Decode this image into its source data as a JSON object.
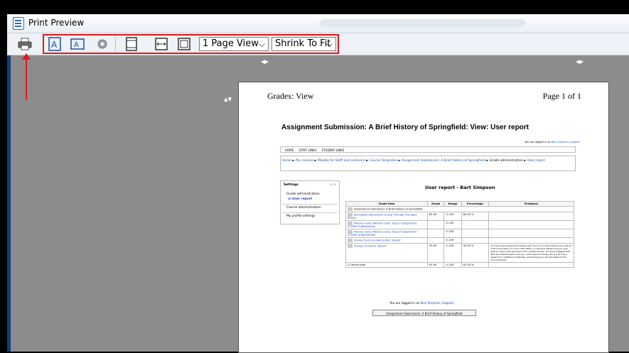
{
  "window": {
    "title": "Print Preview"
  },
  "toolbar": {
    "print_icon": "printer-icon",
    "portrait_icon": "portrait-icon",
    "landscape_icon": "landscape-icon",
    "page_setup_icon": "gear-icon",
    "header_footer_icon": "header-footer-icon",
    "full_width_icon": "full-width-icon",
    "full_page_icon": "full-page-icon",
    "view_select": "1 Page View",
    "scale_select": "Shrink To Fit",
    "highlight_color": "#e01818"
  },
  "page": {
    "header_left": "Grades: View",
    "header_right": "Page 1 of 1",
    "report_title": "Assignment Submission: A Brief History of Springfield: View: User report",
    "logged_text": "You are logged in as",
    "logged_user": "Bart Simpson",
    "logout": "(Logout)",
    "nav": [
      "HOME",
      "STAFF LINKS",
      "STUDENT LINKS"
    ],
    "breadcrumb": [
      "Home",
      "My courses",
      "Moodle for Staff and Lecturers",
      "Course Templates",
      "Assignment Submission: A Brief History of Springfield",
      "Grade administration",
      "User report"
    ],
    "breadcrumb_sep": "►",
    "settings": {
      "title": "Settings",
      "items": [
        "Grade administration",
        "User report",
        "Course administration",
        "My profile settings"
      ]
    },
    "user_report_title": "User report - Bart Simpson",
    "grades_table": {
      "headers": [
        "Grade item",
        "Grade",
        "Range",
        "Percentage",
        "Feedback"
      ],
      "category": "Assignment Submission: A Brief History of Springfield",
      "rows": [
        {
          "item": "Springfield Elementary School Through The Ages: Report",
          "grade": "84.00",
          "range": "0–100",
          "pct": "84.00 %",
          "feedback": ""
        },
        {
          "item": "Module name (Module code): Type of assignment (OTHER SUBMISSION)",
          "grade": "-",
          "range": "0–100",
          "pct": "-",
          "feedback": ""
        },
        {
          "item": "Module name (Module code): Type of assignment (OTHER SUBMISSION)",
          "grade": "-",
          "range": "0–100",
          "pct": "-",
          "feedback": ""
        },
        {
          "item": "Stories from the Kwik-E-Mart: Report",
          "grade": "-",
          "range": "0–100",
          "pct": "-",
          "feedback": ""
        },
        {
          "item": "Nuclear Incidents: Report",
          "grade": "59.00",
          "range": "0–100",
          "pct": "59.00 %",
          "feedback": "You have summarised this subject well, but your in-text references could be a bit more useful. For more information on Harvard referencing you may want to refer to the guidance from / posted earlier.  You have engaged well with the material given, but you could improve this by doing a bit more research for additional materials, and linking your own thoughts to the source themes."
        }
      ],
      "total": {
        "item": "Course total",
        "grade": "61.50",
        "range": "0–100",
        "pct": "61.50 %"
      }
    },
    "course_button": "Assignment Submission: A Brief History of Springfield"
  }
}
